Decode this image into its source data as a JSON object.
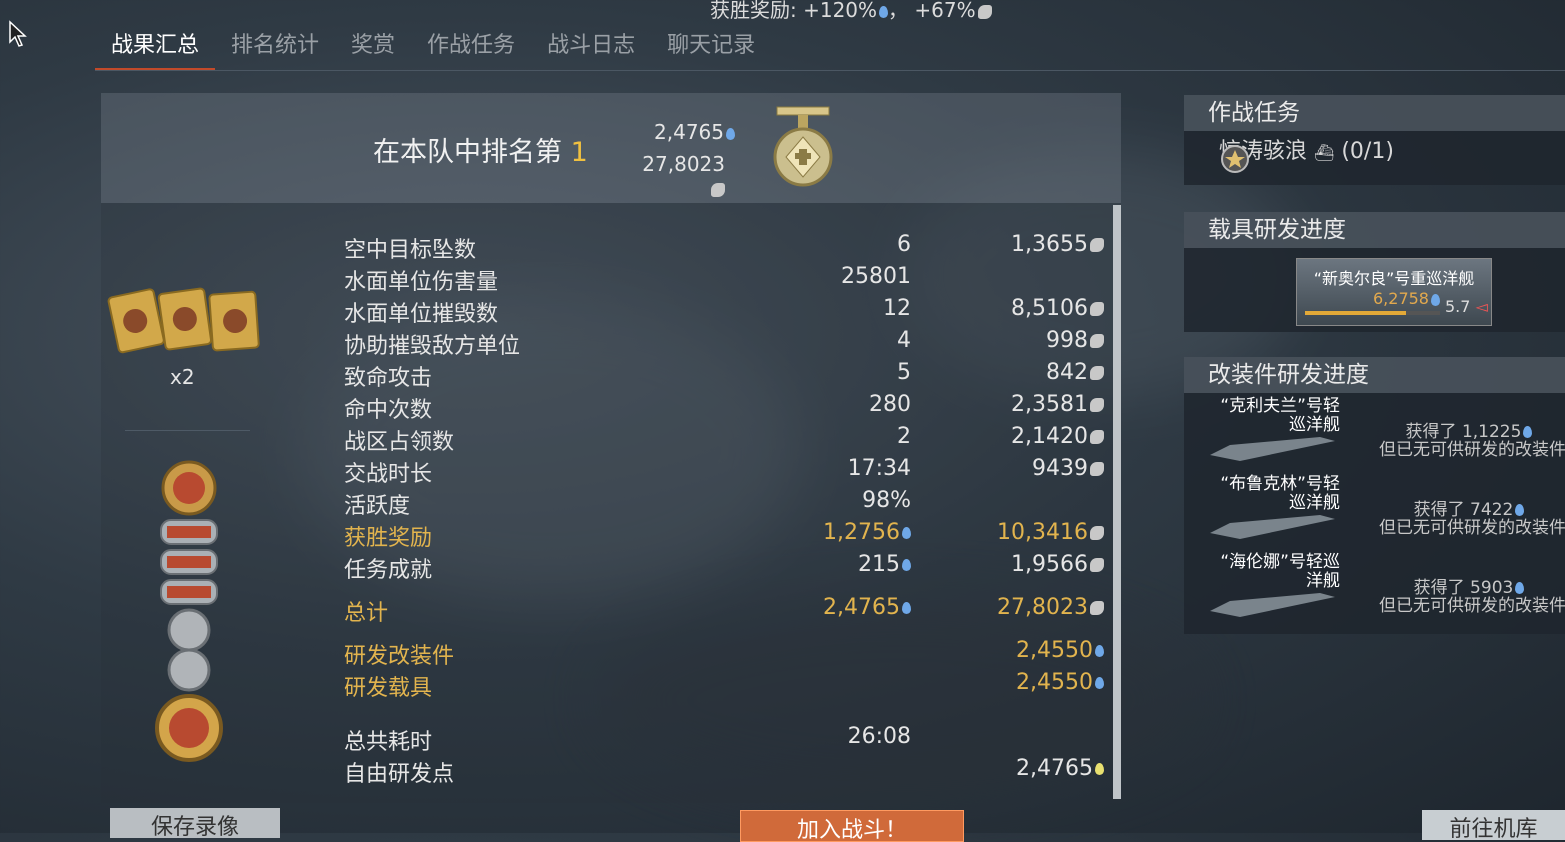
{
  "header": {
    "victory_bonus": "获胜奖励: +120%",
    "victory_bonus_sep": "，",
    "victory_bonus_sl": "+67%"
  },
  "tabs": [
    {
      "label": "战果汇总",
      "active": true
    },
    {
      "label": "排名统计"
    },
    {
      "label": "奖赏"
    },
    {
      "label": "作战任务"
    },
    {
      "label": "战斗日志"
    },
    {
      "label": "聊天记录"
    }
  ],
  "rank": {
    "title": "在本队中排名第",
    "number": "1",
    "rp": "2,4765",
    "sl": "27,8023"
  },
  "left_panel": {
    "cards_multiplier": "x2"
  },
  "stats": [
    {
      "label": "空中目标坠数",
      "v1": "6",
      "v2": "1,3655",
      "v2_icon": "eagle"
    },
    {
      "label": "水面单位伤害量",
      "v1": "25801",
      "v2": ""
    },
    {
      "label": "水面单位摧毁数",
      "v1": "12",
      "v2": "8,5106",
      "v2_icon": "eagle"
    },
    {
      "label": "协助摧毁敌方单位",
      "v1": "4",
      "v2": "998",
      "v2_icon": "eagle"
    },
    {
      "label": "致命攻击",
      "v1": "5",
      "v2": "842",
      "v2_icon": "eagle"
    },
    {
      "label": "命中次数",
      "v1": "280",
      "v2": "2,3581",
      "v2_icon": "eagle"
    },
    {
      "label": "战区占领数",
      "v1": "2",
      "v2": "2,1420",
      "v2_icon": "eagle"
    },
    {
      "label": "交战时长",
      "v1": "17:34",
      "v2": "9439",
      "v2_icon": "eagle"
    },
    {
      "label": "活跃度",
      "v1": "98%",
      "v2": ""
    },
    {
      "label": "获胜奖励",
      "v1": "1,2756",
      "v1_icon": "rp",
      "v2": "10,3416",
      "v2_icon": "eagle",
      "gold": true
    },
    {
      "label": "任务成就",
      "v1": "215",
      "v1_icon": "rp",
      "v2": "1,9566",
      "v2_icon": "eagle"
    }
  ],
  "totals": {
    "total_label": "总计",
    "total_rp": "2,4765",
    "total_sl": "27,8023",
    "mod_label": "研发改装件",
    "mod_rp": "2,4550",
    "veh_label": "研发载具",
    "veh_rp": "2,4550",
    "time_label": "总共耗时",
    "time_value": "26:08",
    "free_label": "自由研发点",
    "free_value": "2,4765"
  },
  "side": {
    "task_title": "作战任务",
    "task_name": "惊涛骇浪",
    "task_progress": "(0/1)",
    "vehicle_title": "载具研发进度",
    "vehicle_name": "“新奥尔良”号重巡洋舰",
    "vehicle_rp": "6,2758",
    "vehicle_br": "5.7",
    "vehicle_progress": 0.75,
    "mods_title": "改装件研发进度",
    "mods": [
      {
        "name": "“克利夫兰”号轻巡洋舰",
        "got": "获得了 1,1225",
        "note": "但已无可供研发的改装件"
      },
      {
        "name": "“布鲁克林”号轻巡洋舰",
        "got": "获得了 7422",
        "note": "但已无可供研发的改装件"
      },
      {
        "name": "“海伦娜”号轻巡洋舰",
        "got": "获得了 5903",
        "note": "但已无可供研发的改装件"
      }
    ]
  },
  "buttons": {
    "save_replay": "保存录像",
    "join_battle": "加入战斗！",
    "garage": "前往机库"
  }
}
